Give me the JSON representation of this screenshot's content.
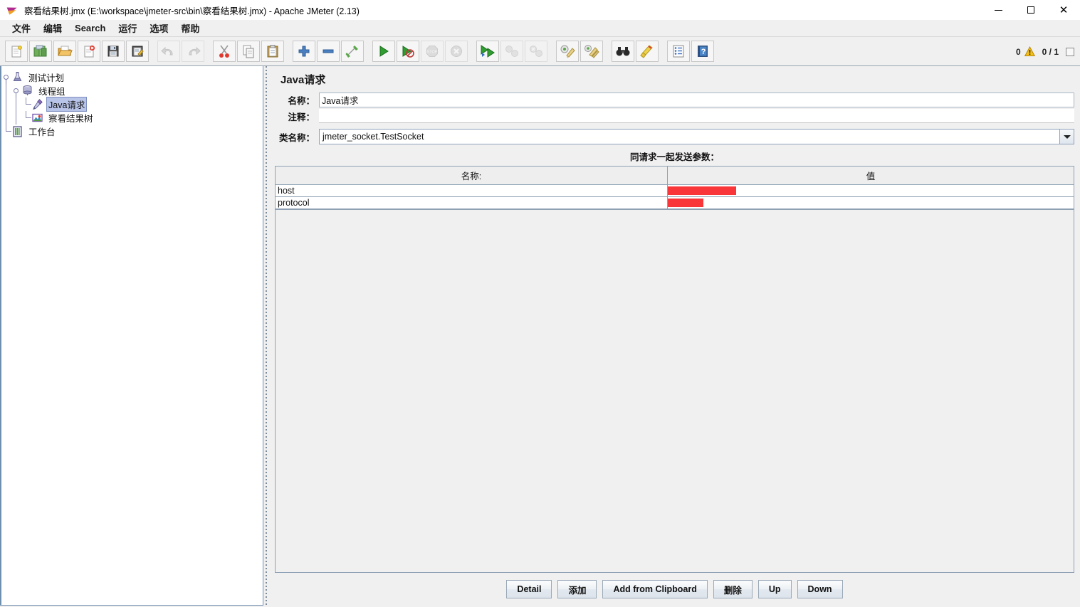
{
  "window": {
    "title": "察看结果树.jmx (E:\\workspace\\jmeter-src\\bin\\察看结果树.jmx) - Apache JMeter (2.13)",
    "app_icon": "jmeter-feather-icon",
    "minimize": "−",
    "maximize": "□",
    "close": "✕"
  },
  "menubar": {
    "items": [
      {
        "label": "文件",
        "name": "menu-file"
      },
      {
        "label": "编辑",
        "name": "menu-edit"
      },
      {
        "label": "Search",
        "name": "menu-search"
      },
      {
        "label": "运行",
        "name": "menu-run"
      },
      {
        "label": "选项",
        "name": "menu-options"
      },
      {
        "label": "帮助",
        "name": "menu-help"
      }
    ]
  },
  "toolbar": {
    "buttons": [
      {
        "icon": "new-document-icon",
        "enabled": true
      },
      {
        "icon": "templates-icon",
        "enabled": true
      },
      {
        "icon": "open-folder-icon",
        "enabled": true
      },
      {
        "icon": "close-document-icon",
        "enabled": true
      },
      {
        "icon": "save-icon",
        "enabled": true
      },
      {
        "icon": "save-as-icon",
        "enabled": true
      },
      {
        "icon": "undo-icon",
        "enabled": false
      },
      {
        "icon": "redo-icon",
        "enabled": false
      },
      {
        "icon": "cut-icon",
        "enabled": true
      },
      {
        "icon": "copy-icon",
        "enabled": true
      },
      {
        "icon": "paste-icon",
        "enabled": true
      },
      {
        "icon": "expand-all-icon",
        "enabled": true
      },
      {
        "icon": "collapse-all-icon",
        "enabled": true
      },
      {
        "icon": "toggle-icon",
        "enabled": true
      },
      {
        "icon": "start-icon",
        "enabled": true
      },
      {
        "icon": "start-no-timers-icon",
        "enabled": true
      },
      {
        "icon": "stop-icon",
        "enabled": false
      },
      {
        "icon": "shutdown-icon",
        "enabled": false
      },
      {
        "icon": "start-remote-all-icon",
        "enabled": true
      },
      {
        "icon": "stop-remote-all-icon",
        "enabled": false
      },
      {
        "icon": "shutdown-remote-all-icon",
        "enabled": false
      },
      {
        "icon": "clear-icon",
        "enabled": true
      },
      {
        "icon": "clear-all-icon",
        "enabled": true
      },
      {
        "icon": "search-icon",
        "enabled": true
      },
      {
        "icon": "search-reset-icon",
        "enabled": true
      },
      {
        "icon": "function-helper-icon",
        "enabled": true
      },
      {
        "icon": "help-icon",
        "enabled": true
      }
    ],
    "status": {
      "warning_count": "0",
      "warning_icon": "warning-triangle-icon",
      "threads_running": "0 / 1"
    }
  },
  "tree": {
    "nodes": [
      {
        "label": "测试计划",
        "icon": "test-plan-flask-icon",
        "depth": 0,
        "selected": false,
        "name": "tree-node-test-plan"
      },
      {
        "label": "线程组",
        "icon": "thread-group-spool-icon",
        "depth": 1,
        "selected": false,
        "name": "tree-node-thread-group"
      },
      {
        "label": "Java请求",
        "icon": "java-request-pipette-icon",
        "depth": 2,
        "selected": true,
        "name": "tree-node-java-request"
      },
      {
        "label": "察看结果树",
        "icon": "view-results-tree-icon",
        "depth": 2,
        "selected": false,
        "name": "tree-node-view-results-tree"
      },
      {
        "label": "工作台",
        "icon": "workbench-icon",
        "depth": 0,
        "selected": false,
        "name": "tree-node-workbench"
      }
    ]
  },
  "main": {
    "panel_title": "Java请求",
    "fields": {
      "name_label": "名称：",
      "name_value": "Java请求",
      "comment_label": "注释：",
      "comment_value": "",
      "comment_placeholder": "",
      "classname_label": "类名称：",
      "classname_value": "jmeter_socket.TestSocket"
    },
    "params": {
      "caption": "同请求一起发送参数：",
      "columns": [
        "名称:",
        "值"
      ],
      "rows": [
        {
          "name": "host",
          "value": "",
          "value_redacted": true,
          "redaction_width": 96
        },
        {
          "name": "protocol",
          "value": "",
          "value_redacted": true,
          "redaction_width": 50
        }
      ]
    },
    "buttons": [
      {
        "label": "Detail",
        "name": "detail-button"
      },
      {
        "label": "添加",
        "name": "add-button"
      },
      {
        "label": "Add from Clipboard",
        "name": "add-from-clipboard-button"
      },
      {
        "label": "删除",
        "name": "delete-button"
      },
      {
        "label": "Up",
        "name": "up-button"
      },
      {
        "label": "Down",
        "name": "down-button"
      }
    ]
  },
  "colors": {
    "redaction": "#f9363a",
    "selection": "#b8c4e8",
    "panel_bg": "#f0f0f0",
    "border": "#8ea1b4"
  }
}
